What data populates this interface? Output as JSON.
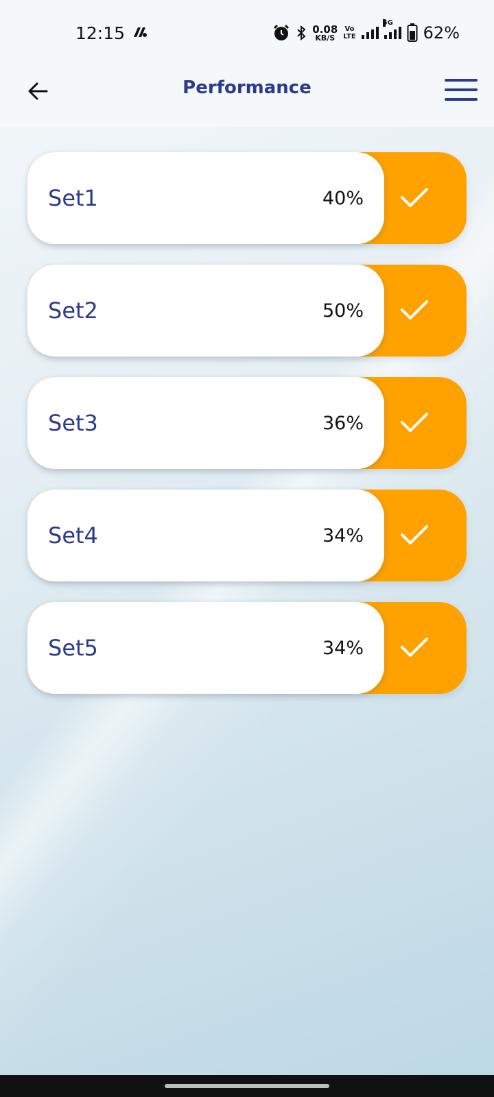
{
  "status_bar": {
    "time": "12:15",
    "net_speed_value": "0.08",
    "net_speed_unit": "KB/S",
    "volte_top": "Vo",
    "volte_bottom": "LTE",
    "network_type": "5G",
    "battery_percent": "62%",
    "icons": [
      "app-notification-icon",
      "alarm-icon",
      "bluetooth-icon",
      "signal-icon",
      "signal-5g-icon",
      "battery-icon"
    ]
  },
  "header": {
    "title": "Performance",
    "back_icon": "arrow-left-icon",
    "menu_icon": "hamburger-menu-icon"
  },
  "sets": [
    {
      "name": "Set1",
      "percent": "40%"
    },
    {
      "name": "Set2",
      "percent": "50%"
    },
    {
      "name": "Set3",
      "percent": "36%"
    },
    {
      "name": "Set4",
      "percent": "34%"
    },
    {
      "name": "Set5",
      "percent": "34%"
    }
  ],
  "colors": {
    "accent": "#ffa200",
    "title_blue": "#2b3a8c",
    "card": "#ffffff"
  }
}
